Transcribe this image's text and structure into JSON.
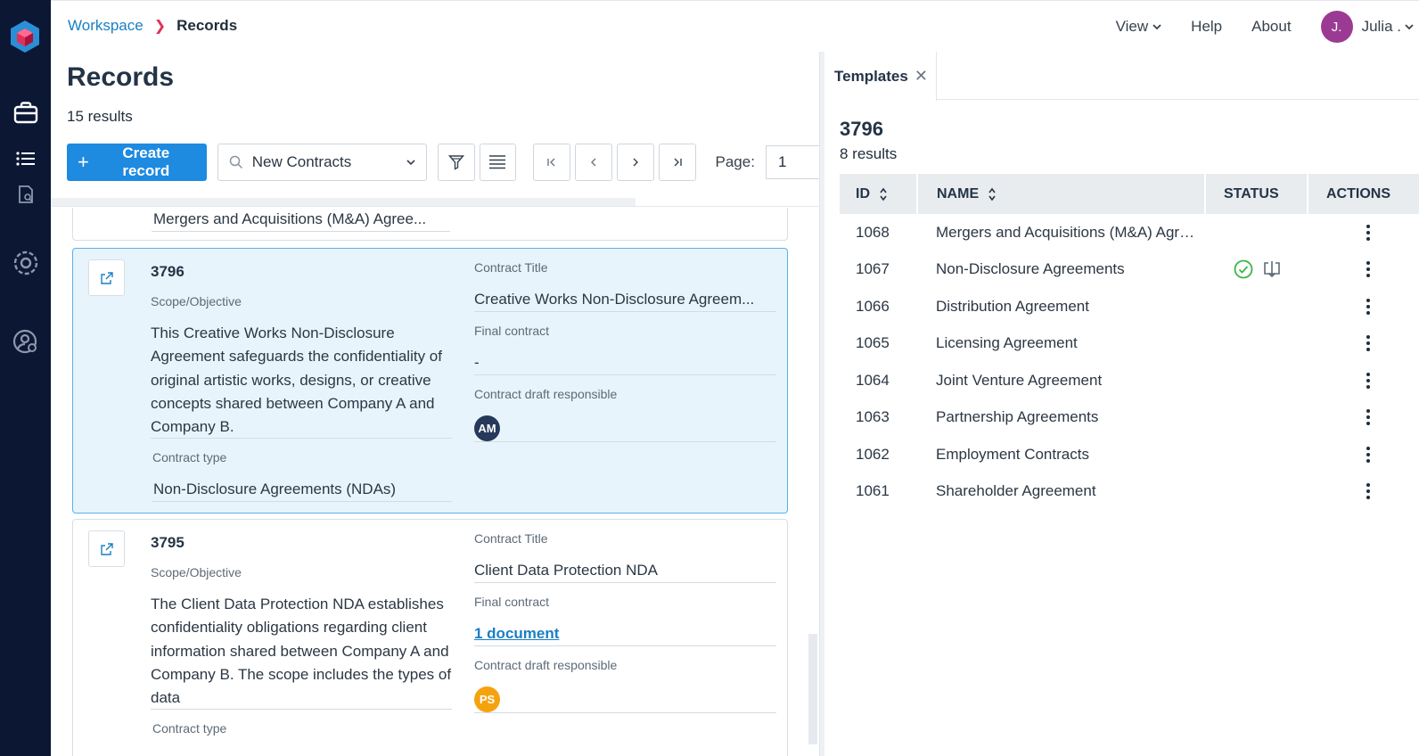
{
  "header": {
    "breadcrumb_root": "Workspace",
    "breadcrumb_current": "Records",
    "nav_view": "View",
    "nav_help": "Help",
    "nav_about": "About",
    "user_initial": "J.",
    "user_name": "Julia ."
  },
  "records": {
    "title": "Records",
    "count": "15 results",
    "create_label": "Create record",
    "view_select": "New Contracts",
    "page_label": "Page:",
    "page_value": "1"
  },
  "cards": {
    "partial_contract_type": "Mergers and Acquisitions (M&A) Agree...",
    "card1": {
      "id": "3796",
      "scope_label": "Scope/Objective",
      "scope": "This Creative Works Non-Disclosure Agreement safeguards the confidentiality of original artistic works, designs, or creative concepts shared between Company A and Company B.",
      "contract_type_label": "Contract type",
      "contract_type": "Non-Disclosure Agreements (NDAs)",
      "title_label": "Contract Title",
      "title": "Creative Works Non-Disclosure Agreem...",
      "final_label": "Final contract",
      "final": "-",
      "responsible_label": "Contract draft responsible",
      "responsible_initials": "AM"
    },
    "card2": {
      "id": "3795",
      "scope_label": "Scope/Objective",
      "scope": "The Client Data Protection NDA establishes confidentiality obligations regarding client information shared between Company A and Company B. The scope includes the types of data",
      "contract_type_label": "Contract type",
      "title_label": "Contract Title",
      "title": "Client Data Protection NDA",
      "final_label": "Final contract",
      "final": "1 document",
      "responsible_label": "Contract draft responsible",
      "responsible_initials": "PS"
    }
  },
  "templates": {
    "tab_label": "Templates",
    "panel_title": "3796",
    "count": "8 results",
    "columns": {
      "id": "ID",
      "name": "NAME",
      "status": "STATUS",
      "actions": "ACTIONS"
    },
    "rows": [
      {
        "id": "1068",
        "name": "Mergers and Acquisitions (M&A) Agree..."
      },
      {
        "id": "1067",
        "name": "Non-Disclosure Agreements",
        "status_icons": [
          "check-circle-icon",
          "download-icon"
        ]
      },
      {
        "id": "1066",
        "name": "Distribution Agreement"
      },
      {
        "id": "1065",
        "name": "Licensing Agreement"
      },
      {
        "id": "1064",
        "name": "Joint Venture Agreement"
      },
      {
        "id": "1063",
        "name": "Partnership Agreements"
      },
      {
        "id": "1062",
        "name": "Employment Contracts"
      },
      {
        "id": "1061",
        "name": "Shareholder Agreement"
      }
    ]
  },
  "colors": {
    "rail": "#0c1734",
    "primary": "#1e8ae0",
    "link": "#1a7fc4",
    "selected_card": "#e8f4fc",
    "user_avatar": "#9b3a93",
    "am_avatar": "#26395a",
    "ps_avatar": "#f5a20f",
    "status_ok": "#3bb54a"
  }
}
